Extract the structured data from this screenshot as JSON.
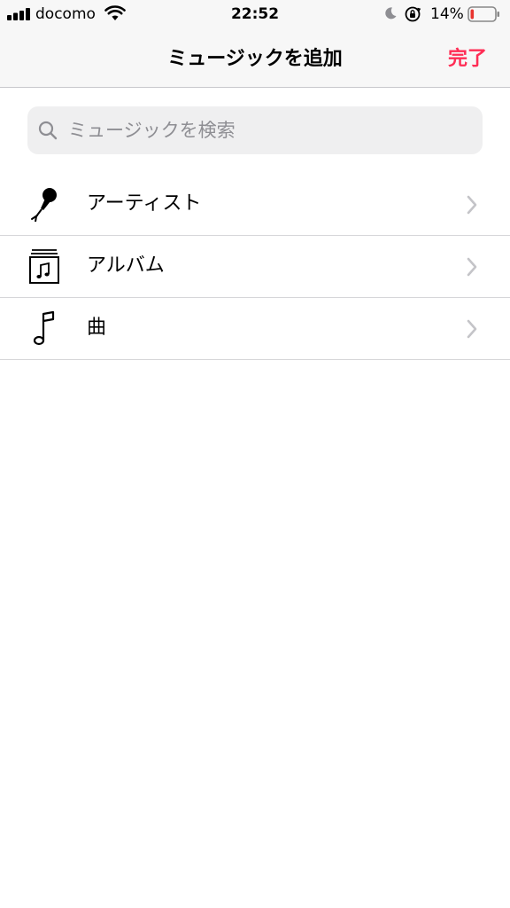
{
  "status_bar": {
    "carrier": "docomo",
    "time": "22:52",
    "battery_percent": "14%",
    "battery_level": 0.14,
    "battery_color": "#e8342f"
  },
  "nav": {
    "title": "ミュージックを追加",
    "done_label": "完了",
    "accent_color": "#ff2d55"
  },
  "search": {
    "placeholder": "ミュージックを検索"
  },
  "list": {
    "items": [
      {
        "label": "アーティスト",
        "icon": "microphone-icon"
      },
      {
        "label": "アルバム",
        "icon": "album-icon"
      },
      {
        "label": "曲",
        "icon": "music-note-icon"
      }
    ]
  }
}
